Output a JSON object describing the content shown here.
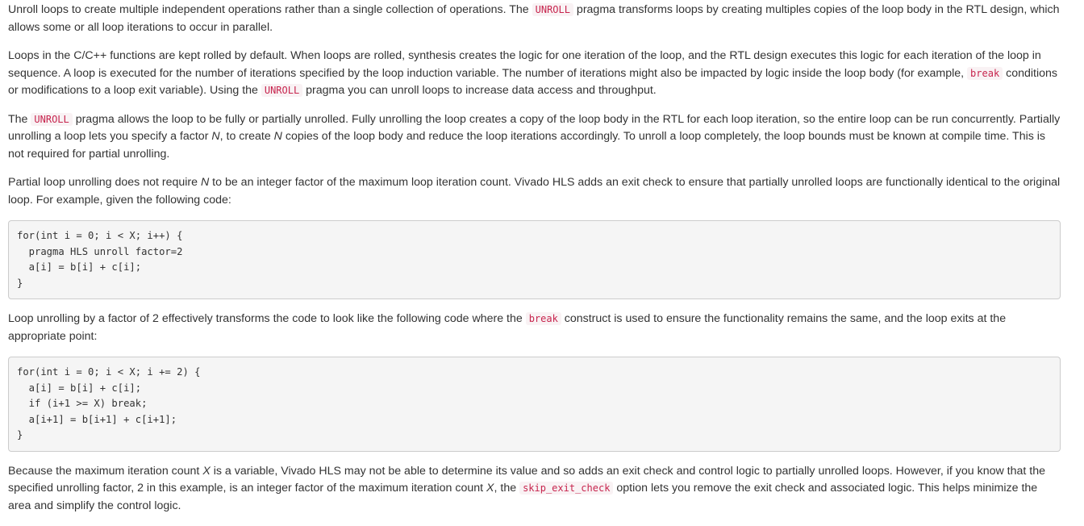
{
  "p1": {
    "t1": "Unroll loops to create multiple independent operations rather than a single collection of operations. The ",
    "c1": "UNROLL",
    "t2": " pragma transforms loops by creating multiples copies of the loop body in the RTL design, which allows some or all loop iterations to occur in parallel."
  },
  "p2": {
    "t1": "Loops in the C/C++ functions are kept rolled by default. When loops are rolled, synthesis creates the logic for one iteration of the loop, and the RTL design executes this logic for each iteration of the loop in sequence. A loop is executed for the number of iterations specified by the loop induction variable. The number of iterations might also be impacted by logic inside the loop body (for example, ",
    "c1": "break",
    "t2": " conditions or modifications to a loop exit variable). Using the ",
    "c2": "UNROLL",
    "t3": " pragma you can unroll loops to increase data access and throughput."
  },
  "p3": {
    "t0": "The ",
    "c1": "UNROLL",
    "t1": " pragma allows the loop to be fully or partially unrolled. Fully unrolling the loop creates a copy of the loop body in the RTL for each loop iteration, so the entire loop can be run concurrently. Partially unrolling a loop lets you specify a factor ",
    "v1": "N",
    "t2": ", to create ",
    "v2": "N",
    "t3": " copies of the loop body and reduce the loop iterations accordingly. To unroll a loop completely, the loop bounds must be known at compile time. This is not required for partial unrolling."
  },
  "p4": {
    "t0": "Partial loop unrolling does not require ",
    "v1": "N",
    "t1": " to be an integer factor of the maximum loop iteration count. Vivado HLS adds an exit check to ensure that partially unrolled loops are functionally identical to the original loop. For example, given the following code:"
  },
  "code1": {
    "lines": [
      "for(int i = 0; i < X; i++) {",
      "  pragma HLS unroll factor=2",
      "  a[i] = b[i] + c[i];",
      "}"
    ]
  },
  "p5": {
    "t1": "Loop unrolling by a factor of 2 effectively transforms the code to look like the following code where the ",
    "c1": "break",
    "t2": " construct is used to ensure the functionality remains the same, and the loop exits at the appropriate point:"
  },
  "code2": {
    "lines": [
      "for(int i = 0; i < X; i += 2) {",
      "  a[i] = b[i] + c[i];",
      "  if (i+1 >= X) break;",
      "  a[i+1] = b[i+1] + c[i+1];",
      "}"
    ]
  },
  "p6": {
    "t0": "Because the maximum iteration count ",
    "v1": "X",
    "t1": " is a variable, Vivado HLS may not be able to determine its value and so adds an exit check and control logic to partially unrolled loops. However, if you know that the specified unrolling factor, 2 in this example, is an integer factor of the maximum iteration count ",
    "v2": "X",
    "t2": ", the ",
    "c1": "skip_exit_check",
    "t3": " option lets you remove the exit check and associated logic. This helps minimize the area and simplify the control logic."
  }
}
